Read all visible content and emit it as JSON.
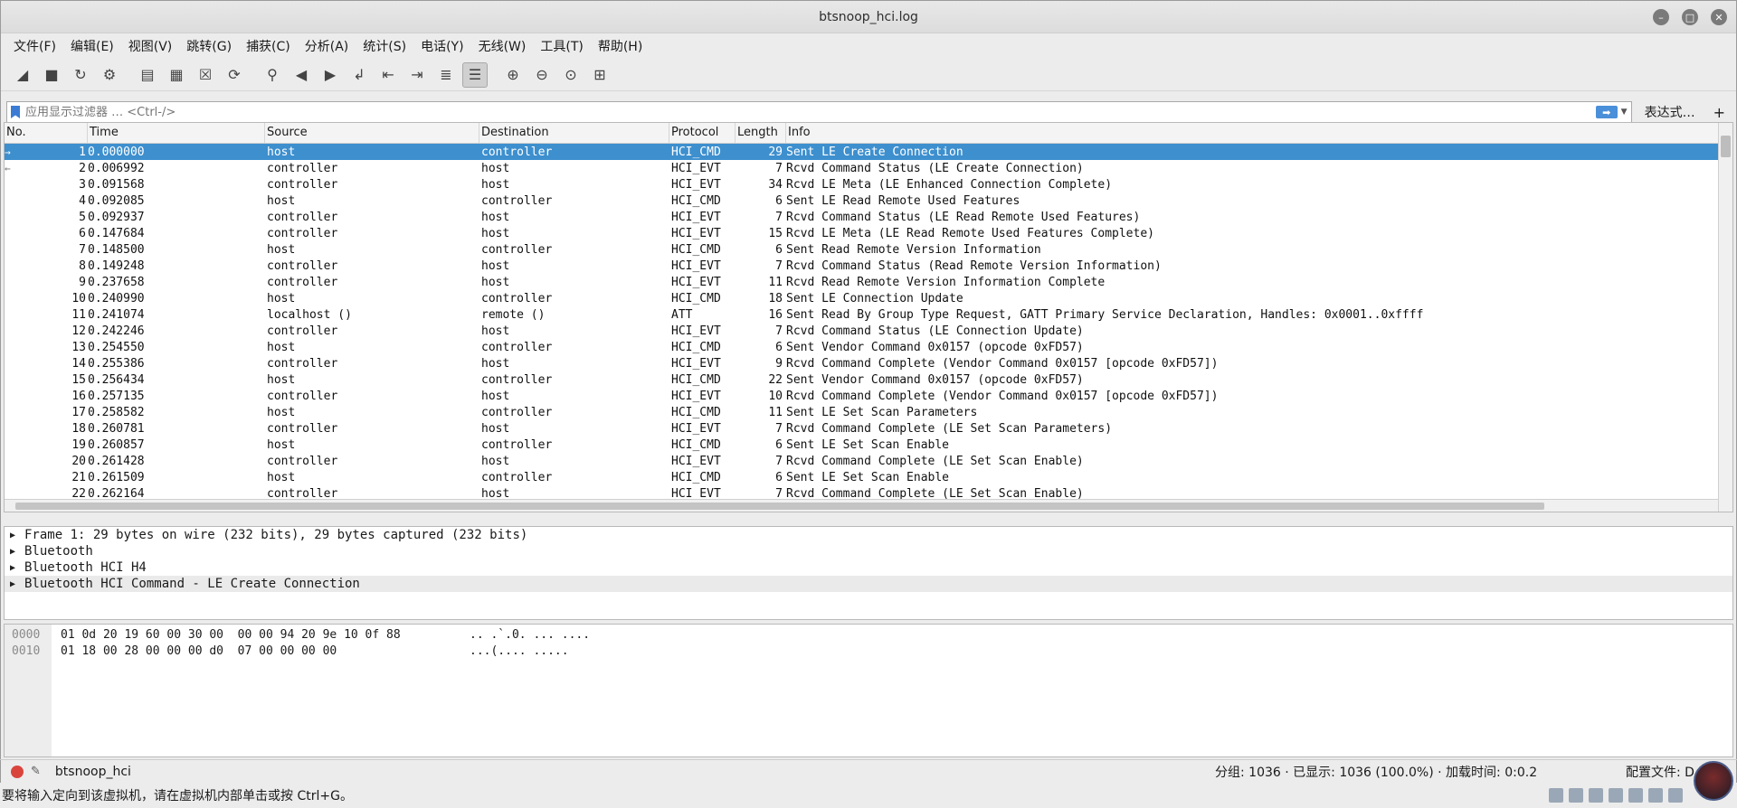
{
  "window": {
    "title": "btsnoop_hci.log"
  },
  "menu": [
    "文件(F)",
    "编辑(E)",
    "视图(V)",
    "跳转(G)",
    "捕获(C)",
    "分析(A)",
    "统计(S)",
    "电话(Y)",
    "无线(W)",
    "工具(T)",
    "帮助(H)"
  ],
  "filter": {
    "placeholder": "应用显示过滤器 … <Ctrl-/>",
    "value": "",
    "expression_label": "表达式…",
    "add_label": "+"
  },
  "columns": [
    "No.",
    "Time",
    "Source",
    "Destination",
    "Protocol",
    "Length",
    "Info"
  ],
  "packets": [
    {
      "no": "1",
      "time": "0.000000",
      "src": "host",
      "dst": "controller",
      "proto": "HCI_CMD",
      "len": "29",
      "info": "Sent LE Create Connection"
    },
    {
      "no": "2",
      "time": "0.006992",
      "src": "controller",
      "dst": "host",
      "proto": "HCI_EVT",
      "len": "7",
      "info": "Rcvd Command Status (LE Create Connection)"
    },
    {
      "no": "3",
      "time": "0.091568",
      "src": "controller",
      "dst": "host",
      "proto": "HCI_EVT",
      "len": "34",
      "info": "Rcvd LE Meta (LE Enhanced Connection Complete)"
    },
    {
      "no": "4",
      "time": "0.092085",
      "src": "host",
      "dst": "controller",
      "proto": "HCI_CMD",
      "len": "6",
      "info": "Sent LE Read Remote Used Features"
    },
    {
      "no": "5",
      "time": "0.092937",
      "src": "controller",
      "dst": "host",
      "proto": "HCI_EVT",
      "len": "7",
      "info": "Rcvd Command Status (LE Read Remote Used Features)"
    },
    {
      "no": "6",
      "time": "0.147684",
      "src": "controller",
      "dst": "host",
      "proto": "HCI_EVT",
      "len": "15",
      "info": "Rcvd LE Meta (LE Read Remote Used Features Complete)"
    },
    {
      "no": "7",
      "time": "0.148500",
      "src": "host",
      "dst": "controller",
      "proto": "HCI_CMD",
      "len": "6",
      "info": "Sent Read Remote Version Information"
    },
    {
      "no": "8",
      "time": "0.149248",
      "src": "controller",
      "dst": "host",
      "proto": "HCI_EVT",
      "len": "7",
      "info": "Rcvd Command Status (Read Remote Version Information)"
    },
    {
      "no": "9",
      "time": "0.237658",
      "src": "controller",
      "dst": "host",
      "proto": "HCI_EVT",
      "len": "11",
      "info": "Rcvd Read Remote Version Information Complete"
    },
    {
      "no": "10",
      "time": "0.240990",
      "src": "host",
      "dst": "controller",
      "proto": "HCI_CMD",
      "len": "18",
      "info": "Sent LE Connection Update"
    },
    {
      "no": "11",
      "time": "0.241074",
      "src": "localhost ()",
      "dst": "remote ()",
      "proto": "ATT",
      "len": "16",
      "info": "Sent Read By Group Type Request, GATT Primary Service Declaration, Handles: 0x0001..0xffff"
    },
    {
      "no": "12",
      "time": "0.242246",
      "src": "controller",
      "dst": "host",
      "proto": "HCI_EVT",
      "len": "7",
      "info": "Rcvd Command Status (LE Connection Update)"
    },
    {
      "no": "13",
      "time": "0.254550",
      "src": "host",
      "dst": "controller",
      "proto": "HCI_CMD",
      "len": "6",
      "info": "Sent Vendor Command 0x0157 (opcode 0xFD57)"
    },
    {
      "no": "14",
      "time": "0.255386",
      "src": "controller",
      "dst": "host",
      "proto": "HCI_EVT",
      "len": "9",
      "info": "Rcvd Command Complete (Vendor Command 0x0157 [opcode 0xFD57])"
    },
    {
      "no": "15",
      "time": "0.256434",
      "src": "host",
      "dst": "controller",
      "proto": "HCI_CMD",
      "len": "22",
      "info": "Sent Vendor Command 0x0157 (opcode 0xFD57)"
    },
    {
      "no": "16",
      "time": "0.257135",
      "src": "controller",
      "dst": "host",
      "proto": "HCI_EVT",
      "len": "10",
      "info": "Rcvd Command Complete (Vendor Command 0x0157 [opcode 0xFD57])"
    },
    {
      "no": "17",
      "time": "0.258582",
      "src": "host",
      "dst": "controller",
      "proto": "HCI_CMD",
      "len": "11",
      "info": "Sent LE Set Scan Parameters"
    },
    {
      "no": "18",
      "time": "0.260781",
      "src": "controller",
      "dst": "host",
      "proto": "HCI_EVT",
      "len": "7",
      "info": "Rcvd Command Complete (LE Set Scan Parameters)"
    },
    {
      "no": "19",
      "time": "0.260857",
      "src": "host",
      "dst": "controller",
      "proto": "HCI_CMD",
      "len": "6",
      "info": "Sent LE Set Scan Enable"
    },
    {
      "no": "20",
      "time": "0.261428",
      "src": "controller",
      "dst": "host",
      "proto": "HCI_EVT",
      "len": "7",
      "info": "Rcvd Command Complete (LE Set Scan Enable)"
    },
    {
      "no": "21",
      "time": "0.261509",
      "src": "host",
      "dst": "controller",
      "proto": "HCI_CMD",
      "len": "6",
      "info": "Sent LE Set Scan Enable"
    },
    {
      "no": "22",
      "time": "0.262164",
      "src": "controller",
      "dst": "host",
      "proto": "HCI_EVT",
      "len": "7",
      "info": "Rcvd Command Complete (LE Set Scan Enable)"
    }
  ],
  "details": [
    "Frame 1: 29 bytes on wire (232 bits), 29 bytes captured (232 bits)",
    "Bluetooth",
    "Bluetooth HCI H4",
    "Bluetooth HCI Command - LE Create Connection"
  ],
  "bytes": [
    {
      "offset": "0000",
      "hex": "01 0d 20 19 60 00 30 00  00 00 94 20 9e 10 0f 88",
      "ascii": ".. .`.0. ... ...."
    },
    {
      "offset": "0010",
      "hex": "01 18 00 28 00 00 00 d0  07 00 00 00 00",
      "ascii": "...(.... ....."
    }
  ],
  "status": {
    "file": "btsnoop_hci",
    "stats": "分组: 1036 · 已显示: 1036 (100.0%) · 加载时间: 0:0.2",
    "profile": "配置文件: D"
  },
  "hint": "要将输入定向到该虚拟机，请在虚拟机内部单击或按 Ctrl+G。",
  "colors": {
    "selected_row": "#3d8fce",
    "recording": "#d9453d"
  }
}
